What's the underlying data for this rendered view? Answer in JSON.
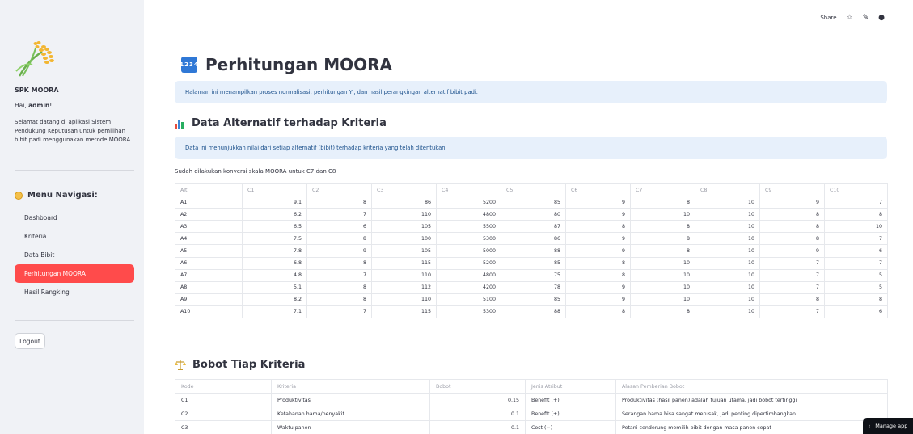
{
  "topbar": {
    "share": "Share",
    "star_icon": "star-icon",
    "edit_icon": "pencil-icon",
    "github_icon": "github-icon",
    "menu_icon": "kebab-menu-icon"
  },
  "sidebar": {
    "app_name": "SPK MOORA",
    "greeting_prefix": "Hai, ",
    "greeting_user": "admin",
    "greeting_suffix": "!",
    "welcome": "Selamat datang di aplikasi Sistem Pendukung Keputusan untuk pemilihan bibit padi menggunakan metode MOORA.",
    "menu_title": "Menu Navigasi:",
    "items": [
      {
        "label": "Dashboard",
        "active": false
      },
      {
        "label": "Kriteria",
        "active": false
      },
      {
        "label": "Data Bibit",
        "active": false
      },
      {
        "label": "Perhitungan MOORA",
        "active": true
      },
      {
        "label": "Hasil Rangking",
        "active": false
      }
    ],
    "logout": "Logout"
  },
  "main": {
    "title": "Perhitungan MOORA",
    "title_icon_text": "1234",
    "intro": "Halaman ini menampilkan proses normalisasi, perhitungan Yi, dan hasil perangkingan alternatif bibit padi.",
    "alt_section_title": "Data Alternatif terhadap Kriteria",
    "alt_info": "Data ini menunjukkan nilai dari setiap alternatif (bibit) terhadap kriteria yang telah ditentukan.",
    "alt_note": "Sudah dilakukan konversi skala MOORA untuk C7 dan C8",
    "alt_table": {
      "headers": [
        "Alt",
        "C1",
        "C2",
        "C3",
        "C4",
        "C5",
        "C6",
        "C7",
        "C8",
        "C9",
        "C10"
      ],
      "rows": [
        [
          "A1",
          "9.1",
          "8",
          "86",
          "5200",
          "85",
          "9",
          "8",
          "10",
          "9",
          "7"
        ],
        [
          "A2",
          "6.2",
          "7",
          "110",
          "4800",
          "80",
          "9",
          "10",
          "10",
          "8",
          "8"
        ],
        [
          "A3",
          "6.5",
          "6",
          "105",
          "5500",
          "87",
          "8",
          "8",
          "10",
          "8",
          "10"
        ],
        [
          "A4",
          "7.5",
          "8",
          "100",
          "5300",
          "86",
          "9",
          "8",
          "10",
          "8",
          "7"
        ],
        [
          "A5",
          "7.8",
          "9",
          "105",
          "5000",
          "88",
          "9",
          "8",
          "10",
          "9",
          "6"
        ],
        [
          "A6",
          "6.8",
          "8",
          "115",
          "5200",
          "85",
          "8",
          "10",
          "10",
          "7",
          "7"
        ],
        [
          "A7",
          "4.8",
          "7",
          "110",
          "4800",
          "75",
          "8",
          "10",
          "10",
          "7",
          "5"
        ],
        [
          "A8",
          "5.1",
          "8",
          "112",
          "4200",
          "78",
          "9",
          "10",
          "10",
          "7",
          "5"
        ],
        [
          "A9",
          "8.2",
          "8",
          "110",
          "5100",
          "85",
          "9",
          "10",
          "10",
          "8",
          "8"
        ],
        [
          "A10",
          "7.1",
          "7",
          "115",
          "5300",
          "88",
          "8",
          "8",
          "10",
          "7",
          "6"
        ]
      ]
    },
    "weight_section_title": "Bobot Tiap Kriteria",
    "weight_table": {
      "headers": [
        "Kode",
        "Kriteria",
        "Bobot",
        "Jenis Atribut",
        "Alasan Pemberian Bobot"
      ],
      "rows": [
        [
          "C1",
          "Produktivitas",
          "0.15",
          "Benefit (+)",
          "Produktivitas (hasil panen) adalah tujuan utama, jadi bobot tertinggi"
        ],
        [
          "C2",
          "Ketahanan hama/penyakit",
          "0.1",
          "Benefit (+)",
          "Serangan hama bisa sangat merusak, jadi penting dipertimbangkan"
        ],
        [
          "C3",
          "Waktu panen",
          "0.1",
          "Cost (−)",
          "Petani cenderung memilih bibit dengan masa panen cepat"
        ]
      ]
    }
  },
  "manage_app": "Manage app"
}
